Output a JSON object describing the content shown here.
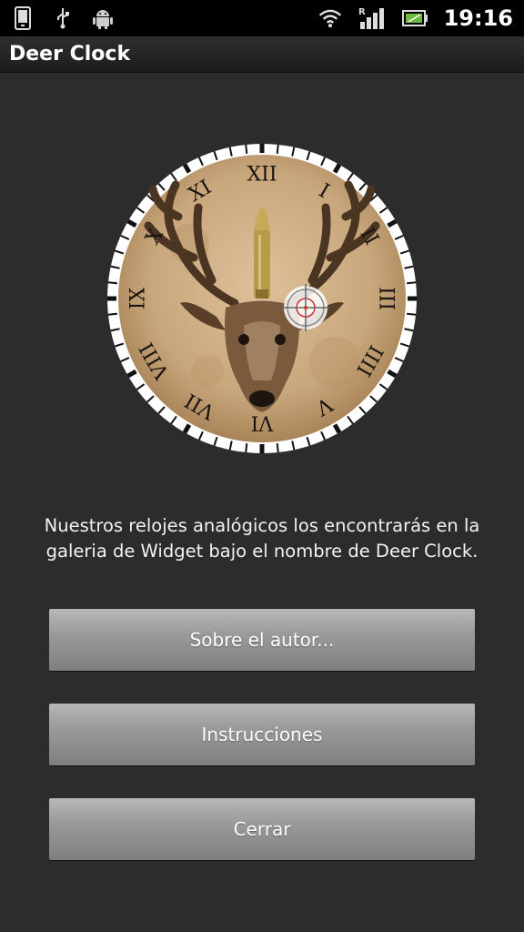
{
  "status_bar": {
    "time": "19:16",
    "icons": [
      "phone-icon",
      "usb-icon",
      "android-icon",
      "wifi-icon",
      "signal-icon",
      "battery-icon"
    ],
    "signal_label": "R"
  },
  "app": {
    "title": "Deer Clock"
  },
  "clock": {
    "numerals": [
      "XII",
      "I",
      "II",
      "III",
      "IIII",
      "V",
      "VI",
      "VII",
      "VIII",
      "IX",
      "X",
      "XI"
    ]
  },
  "main": {
    "description": "Nuestros relojes analógicos los encontrarás en la galeria de Widget bajo el nombre de Deer Clock.",
    "buttons": {
      "about": "Sobre el autor...",
      "instructions": "Instrucciones",
      "close": "Cerrar"
    }
  },
  "colors": {
    "background": "#2c2c2c",
    "status_bar": "#000000",
    "button": "#9a9a9a",
    "clock_face": "#c9a77c"
  }
}
